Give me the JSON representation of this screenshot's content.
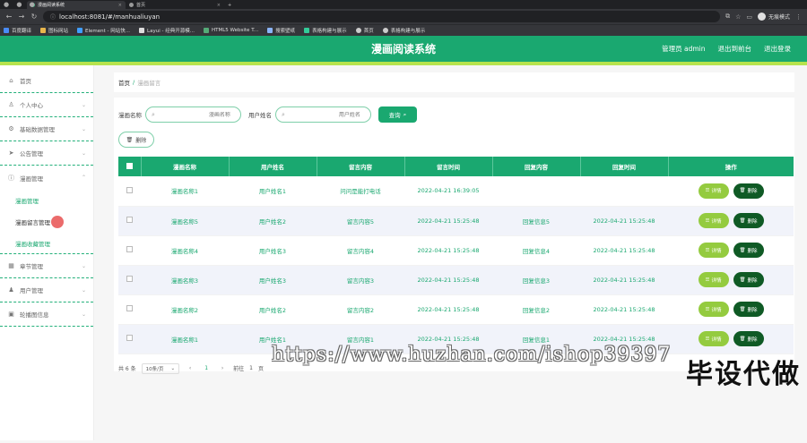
{
  "browser": {
    "tabs": [
      {
        "label": "漫画阅读系统",
        "active": true
      },
      {
        "label": "首页",
        "active": false
      }
    ],
    "url": "localhost:8081/#/manhualiuyan",
    "profile": "无痕模式",
    "bookmarks": [
      "百度翻译",
      "图标网站",
      "Element - 网站快...",
      "Layui - 经典开源模...",
      "HTML5 Website T...",
      "搜索壁纸",
      "表格构建与展示",
      "首页",
      "表格构建与展示"
    ]
  },
  "header": {
    "title": "漫画阅读系统",
    "user": "管理员 admin",
    "back_front": "退出到前台",
    "logout": "退出登录"
  },
  "sidebar": {
    "home": "首页",
    "personal": "个人中心",
    "basic_data": "基础数据管理",
    "notice": "公告管理",
    "comic": "漫画管理",
    "sub_items": [
      "漫画管理",
      "漫画留言管理",
      "漫画收藏管理"
    ],
    "chapter": "章节管理",
    "user": "用户管理",
    "carousel": "轮播图信息"
  },
  "breadcrumb": {
    "home": "首页",
    "sep": "/",
    "current": "漫画留言"
  },
  "search": {
    "label1": "漫画名称",
    "placeholder1": "漫画名称",
    "label2": "用户姓名",
    "placeholder2": "用户姓名",
    "button": "查询"
  },
  "delete_button": "删除",
  "table": {
    "headers": [
      "漫画名称",
      "用户姓名",
      "留言内容",
      "留言时间",
      "回复内容",
      "回复时间",
      "操作"
    ],
    "rows": [
      [
        "漫画名称1",
        "用户姓名1",
        "问问是能打电话",
        "2022-04-21 16:39:05",
        "",
        ""
      ],
      [
        "漫画名称5",
        "用户姓名2",
        "留言内容5",
        "2022-04-21 15:25:48",
        "回复信息5",
        "2022-04-21 15:25:48"
      ],
      [
        "漫画名称4",
        "用户姓名3",
        "留言内容4",
        "2022-04-21 15:25:48",
        "回复信息4",
        "2022-04-21 15:25:48"
      ],
      [
        "漫画名称3",
        "用户姓名3",
        "留言内容3",
        "2022-04-21 15:25:48",
        "回复信息3",
        "2022-04-21 15:25:48"
      ],
      [
        "漫画名称2",
        "用户姓名2",
        "留言内容2",
        "2022-04-21 15:25:48",
        "回复信息2",
        "2022-04-21 15:25:48"
      ],
      [
        "漫画名称1",
        "用户姓名1",
        "留言内容1",
        "2022-04-21 15:25:48",
        "回复信息1",
        "2022-04-21 15:25:48"
      ]
    ],
    "detail_label": "详情",
    "delete_label": "删除"
  },
  "pager": {
    "total": "共 6 条",
    "size": "10条/页",
    "page": "1",
    "goto": "前往",
    "goto_page": "1",
    "page_unit": "页"
  },
  "watermark": {
    "url": "https://www.huzhan.com/ishop39397",
    "text": "毕设代做"
  },
  "colors": {
    "primary": "#1aa870",
    "accent": "#b7e34d",
    "detail": "#94cb3f",
    "delete": "#0f5a25"
  }
}
